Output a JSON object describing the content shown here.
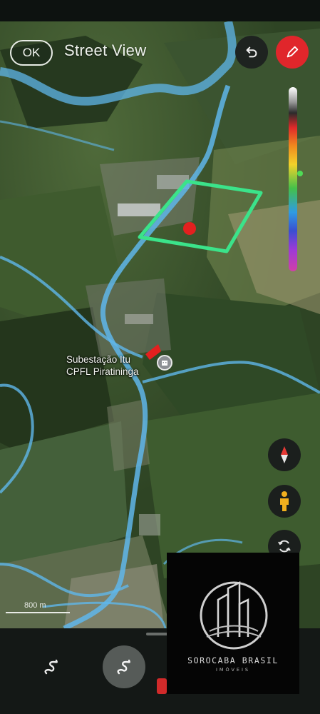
{
  "header": {
    "back_label": "OK",
    "title": "Street View"
  },
  "map": {
    "place_line1": "Subestação Itu",
    "place_line2": "CPFL Piratininga",
    "scale_text": "800 m",
    "outline_color": "#3be38a",
    "road_color": "#5fb6ea",
    "marker_color": "#e3201f"
  },
  "controls": {
    "undo_icon": "undo-icon",
    "pencil_icon": "pencil-icon",
    "compass_icon": "compass-icon",
    "pegman_icon": "pegman-icon",
    "rotate_icon": "rotate-icon",
    "pencil_bg": "#e0262b"
  },
  "bottom_tools": {
    "tool1_icon": "squiggle-icon",
    "tool2_icon": "squiggle-icon"
  },
  "watermark": {
    "name": "SOROCABA BRASIL",
    "sub": "IMÓVEIS"
  }
}
